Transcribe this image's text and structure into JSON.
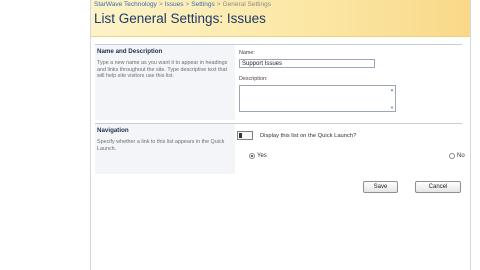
{
  "breadcrumb": {
    "items": [
      "StarWave Technology",
      "Issues",
      "Settings",
      "General Settings"
    ],
    "separator": ">"
  },
  "page_title": "List General Settings: Issues",
  "name_section": {
    "heading": "Name and Description",
    "description": "Type a new name as you want it to appear in headings and links throughout the site. Type descriptive text that will help site visitors use this list.",
    "name_label": "Name:",
    "name_value": "Support Issues",
    "description_label": "Description:",
    "description_value": ""
  },
  "nav_section": {
    "heading": "Navigation",
    "description": "Specify whether a link to this list appears in the Quick Launch.",
    "question": "Display this list on the Quick Launch?",
    "yes_label": "Yes",
    "no_label": "No",
    "selected": "Yes"
  },
  "buttons": {
    "save": "Save",
    "cancel": "Cancel"
  },
  "colors": {
    "title": "#1f3a66",
    "link": "#3b6bb0",
    "band_start": "#fdf3c8",
    "band_end": "#fad889"
  }
}
